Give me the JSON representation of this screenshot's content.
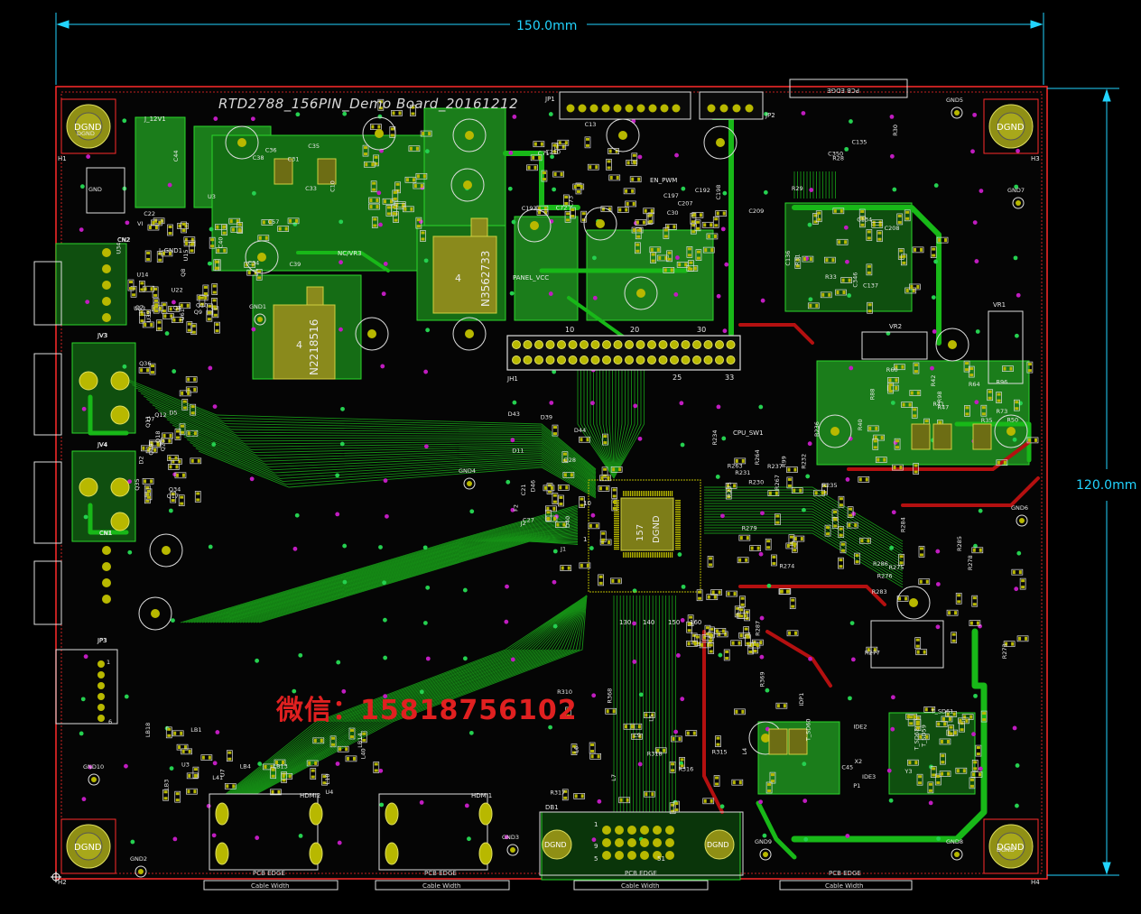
{
  "board": {
    "title": "RTD2788_156PIN_Demo Board_20161212",
    "width_dim": "150.0mm",
    "height_dim": "120.0mm",
    "colors": {
      "background": "#000000",
      "outline": "#ff2a2a",
      "copper": "#1f9a1f",
      "trace_green": "#18b818",
      "silk": "#e8e8e8",
      "pad": "#b8b800",
      "via_magenta": "#c01cc0",
      "dim": "#22d4ff",
      "via_green": "#25d050"
    }
  },
  "watermark": {
    "text": "微信：15818756102"
  },
  "mount_holes": [
    {
      "label": "DGND",
      "ref": "H1"
    },
    {
      "label": "DGND",
      "ref": "H3"
    },
    {
      "label": "DGND",
      "ref": "H2"
    },
    {
      "label": "DGND",
      "ref": "H4"
    }
  ],
  "ics": [
    {
      "ref": "N2218516",
      "num": "4"
    },
    {
      "ref": "N3562733",
      "num": "4"
    },
    {
      "ref": "DGND",
      "num": "157"
    }
  ],
  "connectors": {
    "header_main": {
      "ref": "JH1",
      "pin_labels": [
        "10",
        "20",
        "30",
        "25",
        "33"
      ]
    },
    "jp1": "JP1",
    "jp2": "JP2",
    "jp3": "JP3",
    "jv3": "JV3",
    "jv4": "JV4",
    "cn1": "CN1",
    "cn2": "CN2",
    "hdmi1": "HDMI1",
    "hdmi2": "HDMI2",
    "vr1": "VR1",
    "vr2": "VR2",
    "vr3": "NC/VR3",
    "en_pwm": "EN_PWM",
    "panel_vcc": "PANEL_VCC",
    "cpu_sw1": "CPU_SW1",
    "j12v1": "J_12V1",
    "jgnd1": "J_GND1"
  },
  "ground_labels": [
    "GND1",
    "GND2",
    "GND3",
    "GND4",
    "GND5",
    "GND6",
    "GND7",
    "GND8",
    "GND9",
    "GND10"
  ],
  "edge_labels": [
    "PCB EDGE",
    "PCB EDGE",
    "PCB EDGE",
    "PCB EDGE",
    "PCB EDGE"
  ],
  "cable_labels": [
    "Cable Width",
    "Cable Width",
    "Cable Width",
    "Cable Width"
  ],
  "components": [
    "C31",
    "C34",
    "C38",
    "C22",
    "C33",
    "C35",
    "C36",
    "C39",
    "C40",
    "C44",
    "C57",
    "C10",
    "C13",
    "C30",
    "C71",
    "C72",
    "C73",
    "C192",
    "C193",
    "C197",
    "C198",
    "C210",
    "C209",
    "C207",
    "C208",
    "C134",
    "C135",
    "C136",
    "C137",
    "C346",
    "C350",
    "R28",
    "R29",
    "R30",
    "R31",
    "R33",
    "R35",
    "R40",
    "R41",
    "R42",
    "R47",
    "R50",
    "R60",
    "R64",
    "R73",
    "R88",
    "R96",
    "R98",
    "R99",
    "R230",
    "R231",
    "R232",
    "R233",
    "R234",
    "R235",
    "R236",
    "R237",
    "R263",
    "R264",
    "R267",
    "R273",
    "R274",
    "R275",
    "R276",
    "R277",
    "R278",
    "R279",
    "R283",
    "R284",
    "R285",
    "R286",
    "R287",
    "R310",
    "R315",
    "R316",
    "R317",
    "R318",
    "R368",
    "R369",
    "L4",
    "L5",
    "L6",
    "L7",
    "L9",
    "L10",
    "L40",
    "L41",
    "LB1",
    "LB3",
    "LB4",
    "LB13",
    "LB14",
    "LB18",
    "U3",
    "U4",
    "U7",
    "U14",
    "U15",
    "U22",
    "U34",
    "U39",
    "U53",
    "U61",
    "Q4",
    "Q7",
    "Q8",
    "Q9",
    "Q10",
    "Q11",
    "Q12",
    "Q17",
    "Q18",
    "Q19",
    "Q20",
    "Q34",
    "Q35",
    "Q36",
    "D2",
    "D5",
    "D7",
    "D11",
    "D28",
    "D39",
    "D40",
    "D43",
    "D44",
    "D46",
    "F2",
    "J1",
    "J2",
    "C21",
    "C27",
    "C45",
    "P1",
    "Y3",
    "X2",
    "IDP1",
    "IDE2",
    "IDE3",
    "T_SD61",
    "T_SD62",
    "T_SD59",
    "T_SD60"
  ],
  "chip_pin_labels": [
    "130",
    "140",
    "150",
    "160",
    "1",
    "10"
  ],
  "header_bottom": {
    "ref": "DB1",
    "pin_labels": [
      "1",
      "9",
      "5",
      "51",
      "DGND"
    ]
  },
  "misc_labels": [
    "GND",
    "VI",
    "U3",
    "CN2",
    "JV3",
    "JV4",
    "CN1",
    "JP3",
    "6",
    "1",
    "DGND",
    "DGND"
  ]
}
